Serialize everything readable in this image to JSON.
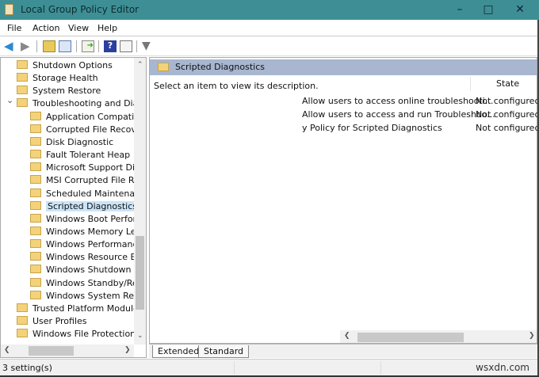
{
  "window": {
    "title": "Local Group Policy Editor"
  },
  "menu": [
    "File",
    "Action",
    "View",
    "Help"
  ],
  "toolbar": {
    "icons": [
      "back-icon",
      "forward-icon",
      "up-folder-icon",
      "show-hide-tree-icon",
      "export-list-icon",
      "help-icon",
      "properties-icon",
      "filter-icon"
    ]
  },
  "tree": {
    "items": [
      {
        "label": "Shutdown Options",
        "level": 1
      },
      {
        "label": "Storage Health",
        "level": 1
      },
      {
        "label": "System Restore",
        "level": 1
      },
      {
        "label": "Troubleshooting and Diagr",
        "level": 1,
        "expanded": true
      },
      {
        "label": "Application Compatibil",
        "level": 2
      },
      {
        "label": "Corrupted File Recovery",
        "level": 2
      },
      {
        "label": "Disk Diagnostic",
        "level": 2
      },
      {
        "label": "Fault Tolerant Heap",
        "level": 2
      },
      {
        "label": "Microsoft Support Diag",
        "level": 2
      },
      {
        "label": "MSI Corrupted File Reco",
        "level": 2
      },
      {
        "label": "Scheduled Maintenanc",
        "level": 2
      },
      {
        "label": "Scripted Diagnostics",
        "level": 2,
        "selected": true
      },
      {
        "label": "Windows Boot Perform",
        "level": 2
      },
      {
        "label": "Windows Memory Leak",
        "level": 2
      },
      {
        "label": "Windows Performance",
        "level": 2
      },
      {
        "label": "Windows Resource Exh",
        "level": 2
      },
      {
        "label": "Windows Shutdown Pe",
        "level": 2
      },
      {
        "label": "Windows Standby/Resu",
        "level": 2
      },
      {
        "label": "Windows System Respo",
        "level": 2
      },
      {
        "label": "Trusted Platform Module S",
        "level": 1
      },
      {
        "label": "User Profiles",
        "level": 1
      },
      {
        "label": "Windows File Protection",
        "level": 1
      }
    ]
  },
  "right": {
    "header": "Scripted Diagnostics",
    "description": "Select an item to view its description.",
    "column_state": "State",
    "policies": [
      {
        "name": "Allow users to access online troubleshooti...",
        "state": "Not configured"
      },
      {
        "name": "Allow users to access and run Troubleshoo...",
        "state": "Not configured"
      },
      {
        "name": "y Policy for Scripted Diagnostics",
        "state": "Not configured"
      }
    ]
  },
  "tabs": [
    "Extended",
    "Standard"
  ],
  "status": {
    "text": "3 setting(s)",
    "watermark": "wsxdn.com"
  }
}
